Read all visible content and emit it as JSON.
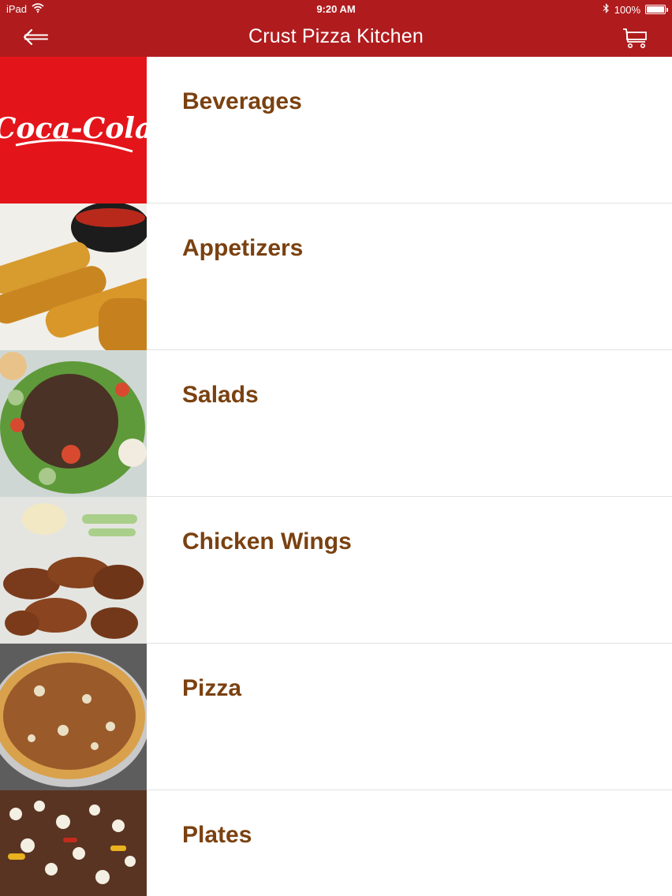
{
  "status": {
    "device": "iPad",
    "time": "9:20 AM",
    "battery": "100%",
    "battery_level": 1.0
  },
  "nav": {
    "title": "Crust Pizza Kitchen",
    "back_icon": "arrow-left-icon",
    "cart_icon": "cart-icon"
  },
  "theme": {
    "header_bg": "#b01c1e",
    "label_color": "#7a4110",
    "divider": "#e2e2e2"
  },
  "categories": [
    {
      "label": "Beverages",
      "image": "coca-cola-logo"
    },
    {
      "label": "Appetizers",
      "image": "mozzarella-sticks-photo"
    },
    {
      "label": "Salads",
      "image": "salad-photo"
    },
    {
      "label": "Chicken Wings",
      "image": "chicken-wings-photo"
    },
    {
      "label": "Pizza",
      "image": "pizza-photo"
    },
    {
      "label": "Plates",
      "image": "plates-photo"
    }
  ]
}
